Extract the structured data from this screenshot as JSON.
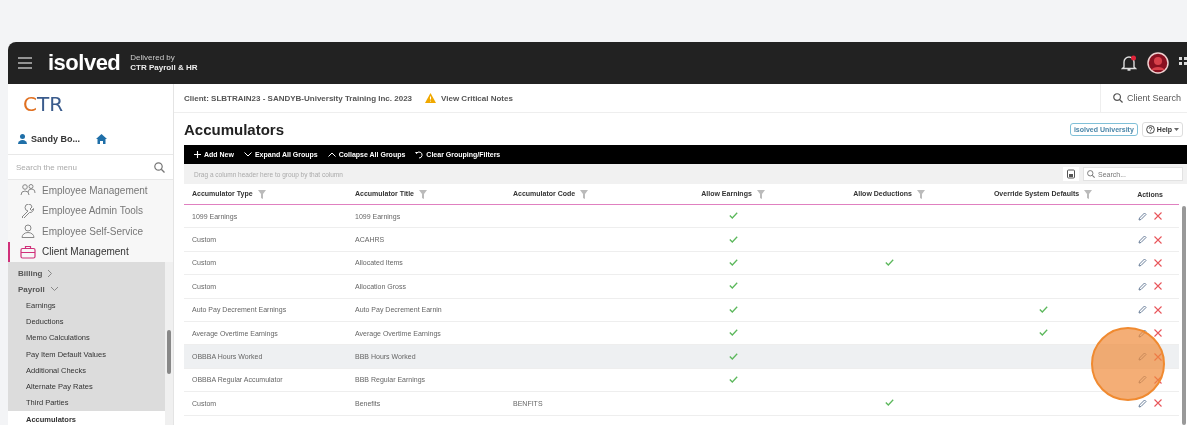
{
  "header": {
    "brand": "isolved",
    "delivered_by": "Delivered by",
    "partner": "CTR Payroll & HR",
    "notification_dot": true
  },
  "sidebar": {
    "logo": "CTR",
    "user": "Sandy Bo...",
    "search": {
      "placeholder": "Search the menu"
    },
    "items": [
      {
        "label": "Employee Management",
        "kind": "people",
        "selected": false
      },
      {
        "label": "Employee Admin Tools",
        "kind": "wrench",
        "selected": false
      },
      {
        "label": "Employee Self-Service",
        "kind": "person",
        "selected": false
      },
      {
        "label": "Client Management",
        "kind": "briefcase",
        "selected": true
      }
    ],
    "submenu": [
      {
        "label": "Billing",
        "expanded": false
      },
      {
        "label": "Payroll",
        "expanded": true,
        "children": [
          {
            "label": "Earnings",
            "selected": false
          },
          {
            "label": "Deductions",
            "selected": false
          },
          {
            "label": "Memo Calculations",
            "selected": false
          },
          {
            "label": "Pay Item Default Values",
            "selected": false
          },
          {
            "label": "Additional Checks",
            "selected": false
          },
          {
            "label": "Alternate Pay Rates",
            "selected": false
          },
          {
            "label": "Third Parties",
            "selected": false
          },
          {
            "label": "Accumulators",
            "selected": true
          }
        ]
      }
    ]
  },
  "client_bar": {
    "client": "Client: SLBTRAIN23 - SANDYB-University Training Inc. 2023",
    "notes_link": "View Critical Notes",
    "client_search": "Client Search"
  },
  "page": {
    "title": "Accumulators",
    "university_button": "isolved University",
    "help_button": "Help"
  },
  "toolbar": [
    {
      "label": "Add New",
      "kind": "plus"
    },
    {
      "label": "Expand All Groups",
      "kind": "expand"
    },
    {
      "label": "Collapse All Groups",
      "kind": "collapse"
    },
    {
      "label": "Clear Grouping/Filters",
      "kind": "reset"
    }
  ],
  "group_hint": "Drag a column header here to group by that column",
  "grid_search": {
    "placeholder": "Search..."
  },
  "table": {
    "columns": [
      "Accumulator Type",
      "Accumulator Title",
      "Accumulator Code",
      "Allow Earnings",
      "Allow Deductions",
      "Override System Defaults",
      "Actions"
    ],
    "rows": [
      {
        "type": "1099 Earnings",
        "title": "1099 Earnings",
        "allow_earnings": true,
        "allow_deductions": false,
        "override": false,
        "selected": false
      },
      {
        "type": "Custom",
        "title": "ACAHRS",
        "allow_earnings": true,
        "allow_deductions": false,
        "override": false,
        "selected": false
      },
      {
        "type": "Custom",
        "title": "Allocated Items",
        "allow_earnings": true,
        "allow_deductions": true,
        "override": false,
        "selected": false
      },
      {
        "type": "Custom",
        "title": "Allocation Gross",
        "allow_earnings": true,
        "allow_deductions": false,
        "override": false,
        "selected": false
      },
      {
        "type": "Auto Pay Decrement Earnings",
        "title": "Auto Pay Decrement Earnin",
        "allow_earnings": true,
        "allow_deductions": false,
        "override": true,
        "selected": false
      },
      {
        "type": "Average Overtime Earnings",
        "title": "Average Overtime Earnings",
        "allow_earnings": true,
        "allow_deductions": false,
        "override": true,
        "selected": false
      },
      {
        "type": "OBBBA Hours Worked",
        "title": "BBB Hours Worked",
        "allow_earnings": true,
        "allow_deductions": false,
        "override": false,
        "selected": true
      },
      {
        "type": "OBBBA Regular Accumulator",
        "title": "BBB Regular Earnings",
        "allow_earnings": true,
        "allow_deductions": false,
        "override": false,
        "selected": false
      },
      {
        "type": "Custom",
        "title": "Benefits",
        "code": "BENFITS",
        "allow_earnings": false,
        "allow_deductions": true,
        "override": false,
        "selected": false
      }
    ]
  }
}
